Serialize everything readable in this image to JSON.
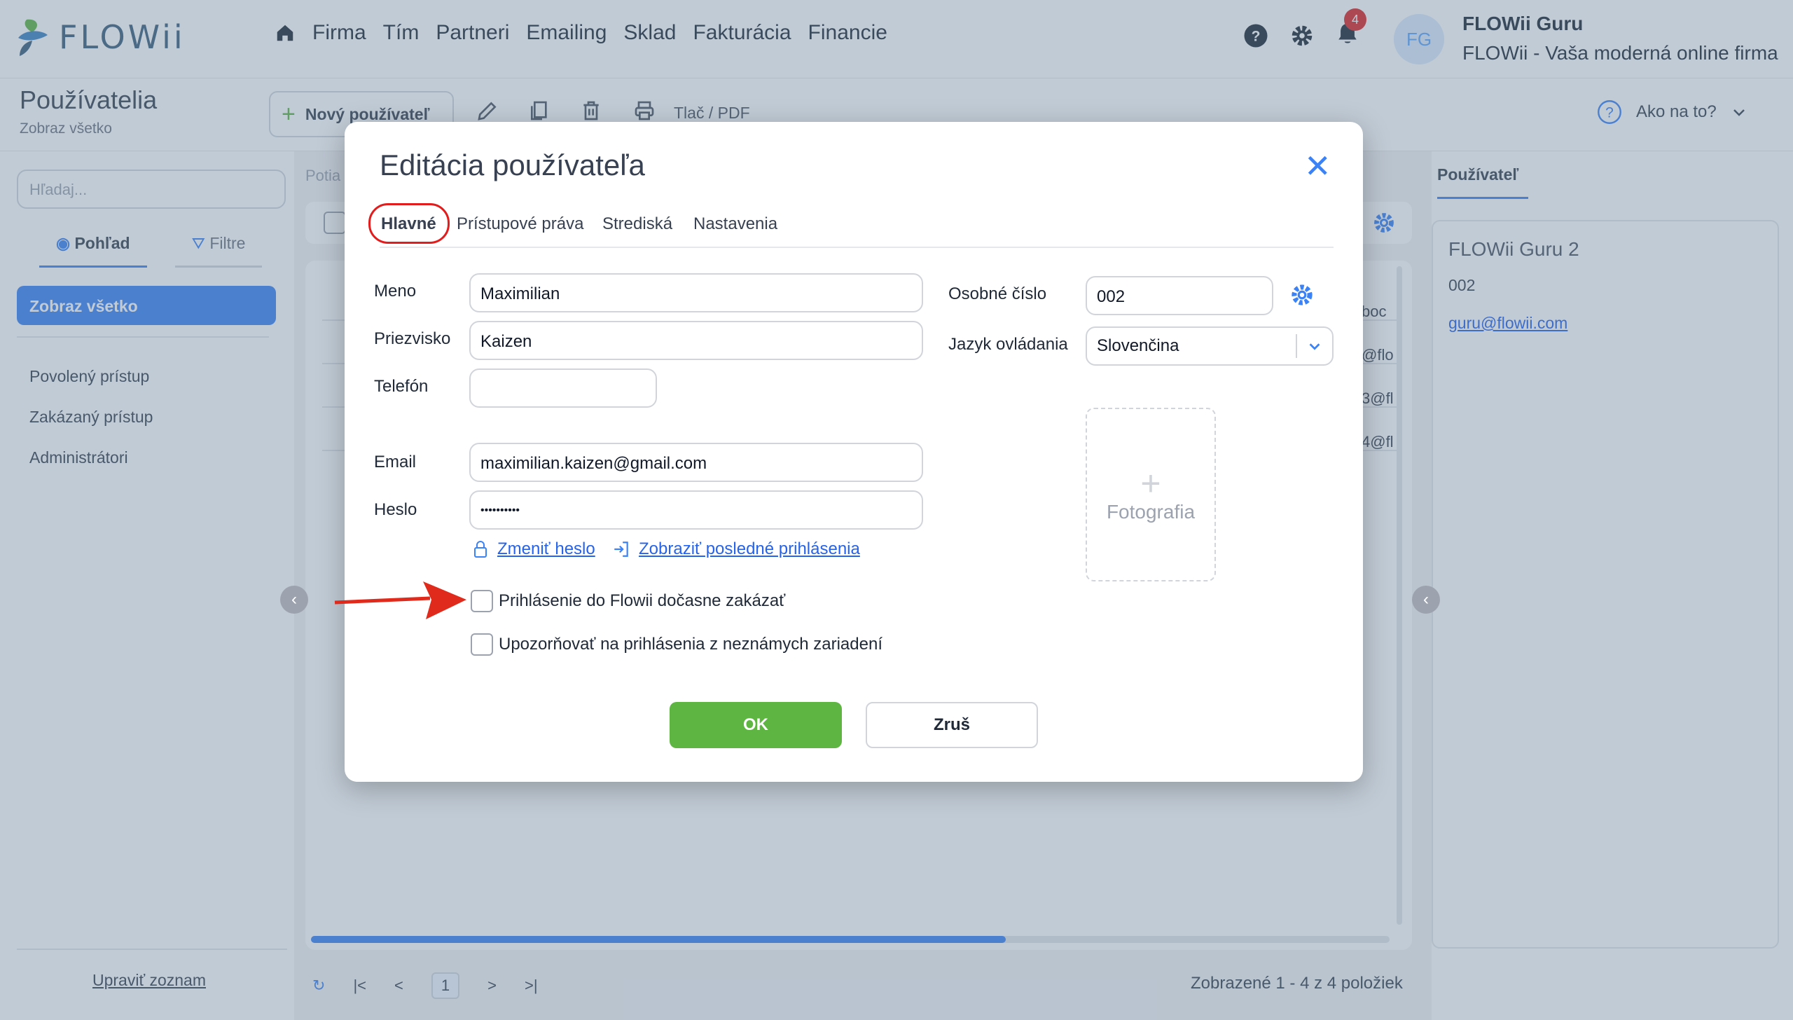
{
  "app": {
    "logo": "FLOWii",
    "nav": [
      "Firma",
      "Tím",
      "Partneri",
      "Emailing",
      "Sklad",
      "Fakturácia",
      "Financie"
    ],
    "notifications_count": "4",
    "avatar_initials": "FG",
    "user_name": "FLOWii Guru",
    "user_firm": "FLOWii - Vaša moderná online firma",
    "accent_color": "#3b82f6"
  },
  "subbar": {
    "title": "Používatelia",
    "subtitle": "Zobraz všetko",
    "new_user": "Nový používateľ",
    "print_pdf": "Tlač / PDF",
    "help": "Ako na to?"
  },
  "left": {
    "search_placeholder": "Hľadaj...",
    "tabs": [
      "Pohľad",
      "Filtre"
    ],
    "selected": "Zobraz všetko",
    "items": [
      "Povolený prístup",
      "Zakázaný prístup",
      "Administrátori"
    ],
    "edit_list": "Upraviť zoznam"
  },
  "center": {
    "header_partial": "Potia",
    "row_fragments": [
      "boc",
      "@flo",
      "3@fl",
      "4@fl"
    ],
    "page": "1",
    "count_text": "Zobrazené 1 - 4 z 4 položiek",
    "scroll_fraction": 0.644
  },
  "right": {
    "tab": "Používateľ",
    "name": "FLOWii Guru 2",
    "number": "002",
    "email": "guru@flowii.com"
  },
  "modal": {
    "title": "Editácia používateľa",
    "tabs": [
      "Hlavné",
      "Prístupové práva",
      "Strediská",
      "Nastavenia"
    ],
    "labels": {
      "meno": "Meno",
      "priezvisko": "Priezvisko",
      "telefon": "Telefón",
      "email": "Email",
      "heslo": "Heslo",
      "osobne": "Osobné číslo",
      "jazyk": "Jazyk ovládania"
    },
    "values": {
      "meno": "Maximilian",
      "priezvisko": "Kaizen",
      "telefon": "",
      "email": "maximilian.kaizen@gmail.com",
      "heslo": "••••••••••",
      "osobne": "002",
      "jazyk": "Slovenčina"
    },
    "change_password": "Zmeniť heslo",
    "show_logins": "Zobraziť posledné prihlásenia",
    "photo": "Fotografia",
    "checkbox1": "Prihlásenie do Flowii dočasne zakázať",
    "checkbox2": "Upozorňovať na prihlásenia z neznámych zariadení",
    "ok": "OK",
    "cancel": "Zruš",
    "annotation_color": "#e11d1d"
  }
}
